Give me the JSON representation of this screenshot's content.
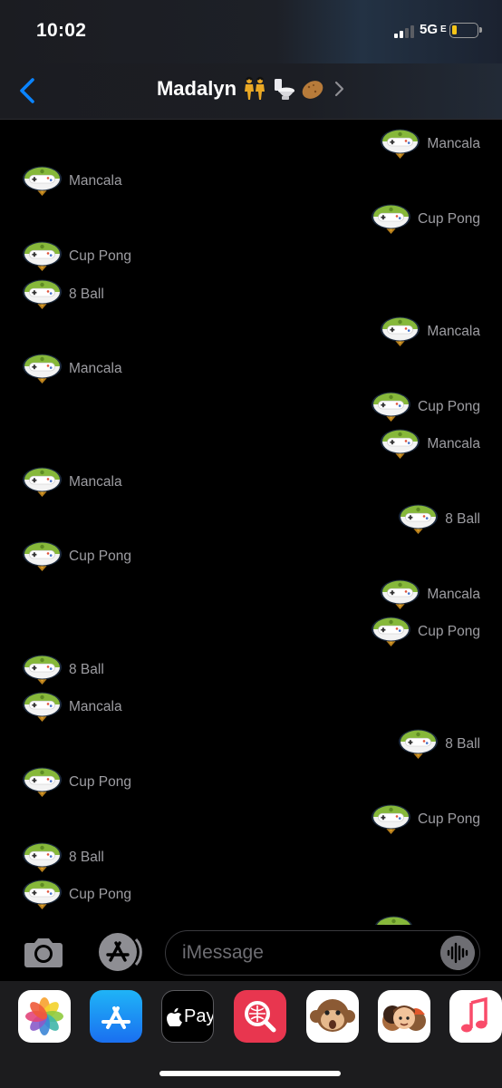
{
  "status_bar": {
    "time": "10:02",
    "network": "5G",
    "network_suffix": "E"
  },
  "header": {
    "contact_name": "Madalyn",
    "contact_emojis": [
      "dancing-women-emoji",
      "toilet-emoji",
      "potato-emoji"
    ]
  },
  "messages": [
    {
      "dir": "out",
      "text": "Mancala"
    },
    {
      "dir": "in",
      "text": "Mancala"
    },
    {
      "dir": "out",
      "text": "Cup Pong"
    },
    {
      "dir": "in",
      "text": "Cup Pong"
    },
    {
      "dir": "in",
      "text": "8 Ball"
    },
    {
      "dir": "out",
      "text": "Mancala"
    },
    {
      "dir": "in",
      "text": "Mancala"
    },
    {
      "dir": "out",
      "text": "Cup Pong"
    },
    {
      "dir": "out",
      "text": "Mancala"
    },
    {
      "dir": "in",
      "text": "Mancala"
    },
    {
      "dir": "out",
      "text": "8 Ball"
    },
    {
      "dir": "in",
      "text": "Cup Pong"
    },
    {
      "dir": "out",
      "text": "Mancala"
    },
    {
      "dir": "out",
      "text": "Cup Pong"
    },
    {
      "dir": "in",
      "text": "8 Ball"
    },
    {
      "dir": "in",
      "text": "Mancala"
    },
    {
      "dir": "out",
      "text": "8 Ball"
    },
    {
      "dir": "in",
      "text": "Cup Pong"
    },
    {
      "dir": "out",
      "text": "Cup Pong"
    },
    {
      "dir": "in",
      "text": "8 Ball"
    },
    {
      "dir": "in",
      "text": "Cup Pong"
    }
  ],
  "compose": {
    "placeholder": "iMessage"
  },
  "app_drawer": {
    "apple_pay_label": "Pay",
    "apps": [
      "photos-app-icon",
      "app-store-app-icon",
      "apple-pay-app-icon",
      "image-search-app-icon",
      "monkey-memoji-app-icon",
      "memoji-stickers-app-icon",
      "music-app-icon"
    ]
  },
  "colors": {
    "accent": "#0a84ff",
    "label_gray": "#9d9da2",
    "background": "#000000",
    "pigeon_green": "#8bc34a"
  }
}
